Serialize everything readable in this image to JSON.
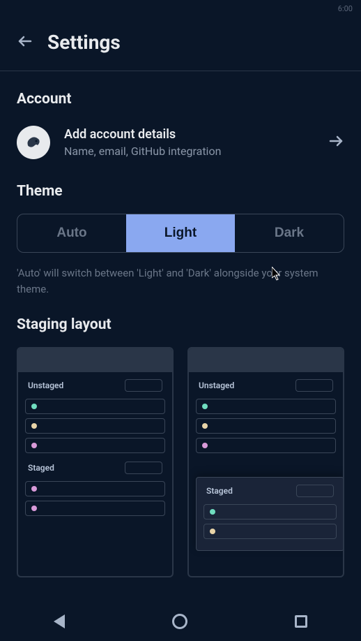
{
  "statusBar": {
    "time": "6:00"
  },
  "header": {
    "title": "Settings"
  },
  "sections": {
    "account": {
      "title": "Account",
      "item": {
        "title": "Add account details",
        "subtitle": "Name, email, GitHub integration"
      }
    },
    "theme": {
      "title": "Theme",
      "options": {
        "auto": "Auto",
        "light": "Light",
        "dark": "Dark"
      },
      "selected": "light",
      "help": "'Auto' will switch between 'Light' and 'Dark' alongside your system theme."
    },
    "stagingLayout": {
      "title": "Staging layout",
      "cards": [
        {
          "sections": [
            {
              "label": "Unstaged",
              "dots": [
                "teal",
                "cream",
                "pink"
              ]
            },
            {
              "label": "Staged",
              "dots": [
                "pink",
                "pink"
              ]
            }
          ]
        },
        {
          "baseSection": {
            "label": "Unstaged",
            "dots": [
              "teal",
              "cream",
              "pink"
            ]
          },
          "overlaySection": {
            "label": "Staged",
            "dots": [
              "teal",
              "cream"
            ]
          }
        }
      ]
    }
  }
}
